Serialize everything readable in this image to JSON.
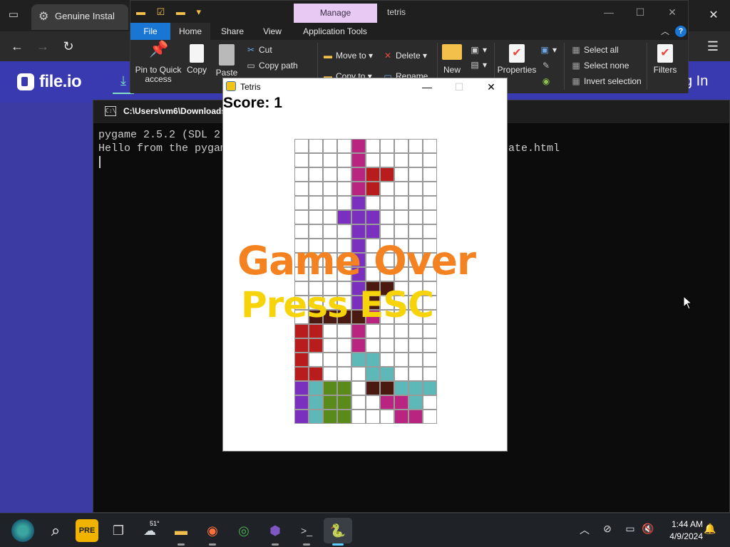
{
  "browser": {
    "tab_title": "Genuine Instal",
    "close_glyph": "✕",
    "site": {
      "logo_text": "file.io",
      "login_link": "g In"
    }
  },
  "terminal": {
    "title": "C:\\Users\\vm6\\Downloads",
    "lines": [
      "pygame 2.5.2 (SDL 2",
      "Hello from the pygam",
      "ate.html"
    ]
  },
  "explorer": {
    "manage_tab": "Manage",
    "title": "tetris",
    "tabs": {
      "file": "File",
      "home": "Home",
      "share": "Share",
      "view": "View",
      "app_tools": "Application Tools"
    },
    "ribbon": {
      "pin": "Pin to Quick access",
      "copy": "Copy",
      "paste": "Paste",
      "cut": "Cut",
      "copy_path": "Copy path",
      "move_to": "Move to",
      "delete": "Delete",
      "copy_to": "Copy to",
      "rename": "Rename",
      "new": "New",
      "properties": "Properties",
      "select_all": "Select all",
      "select_none": "Select none",
      "invert_selection": "Invert selection",
      "filters": "Filters"
    },
    "help_glyph": "?"
  },
  "tetris": {
    "window_title": "Tetris",
    "score_text": "Score: 1",
    "game_over_text": "Game Over",
    "press_esc_text": "Press ESC",
    "game_over_color": "#f58220",
    "press_esc_color": "#f7d30a",
    "colors": {
      "m": "#b8247f",
      "r": "#b81c1c",
      "p": "#7a2fbf",
      "b": "#4a1a10",
      "c": "#5fb8b8",
      "g": "#5a8a1a"
    },
    "grid": [
      "....m.....",
      "....m.....",
      "....mrr...",
      "....mr....",
      "....p.....",
      "...ppp....",
      "....pp....",
      "....p.....",
      "....p.....",
      "....p.....",
      "....pbb...",
      "....pb....",
      ".bbbbm....",
      "rr..m.....",
      "rr..m.....",
      "r...cc....",
      "rr...cc...",
      "pcgg.bbccc",
      "pcgg..mmc.",
      "pcgg...mm."
    ]
  },
  "taskbar": {
    "weather_temp": "51°",
    "time": "1:44 AM",
    "date": "4/9/2024"
  }
}
